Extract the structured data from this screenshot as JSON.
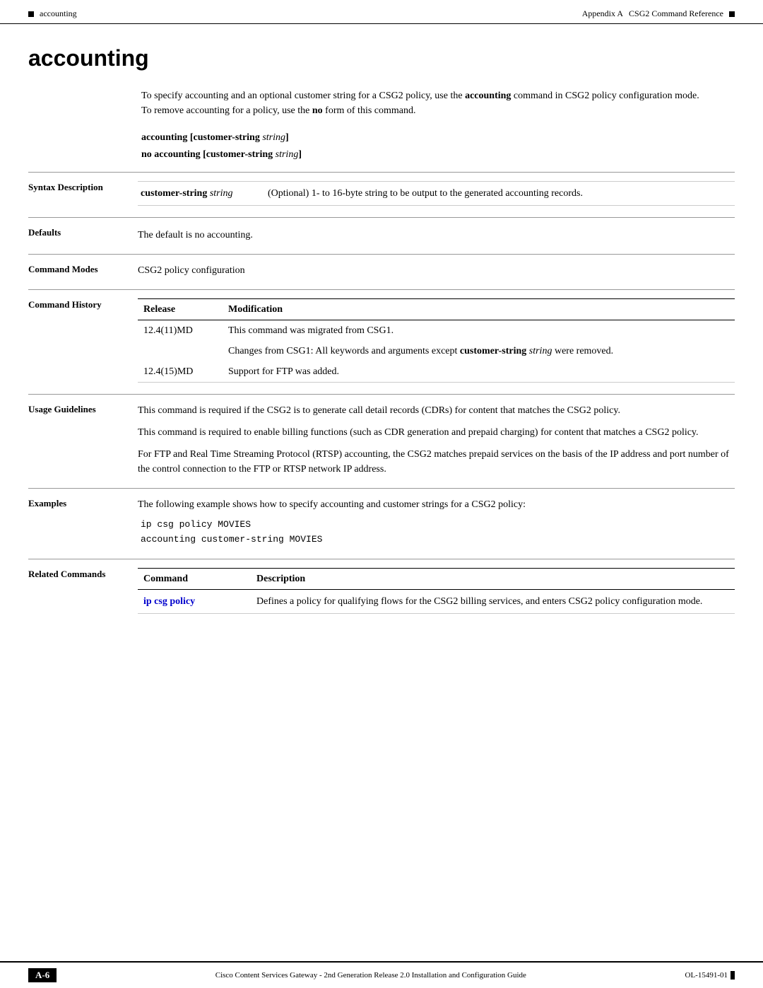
{
  "header": {
    "left_label": "accounting",
    "right_label": "Appendix A",
    "right_section": "CSG2 Command Reference"
  },
  "page_title": "accounting",
  "intro": {
    "text1": "To specify accounting and an optional customer string for a CSG2 policy, use the ",
    "bold1": "accounting",
    "text2": " command in CSG2 policy configuration mode. To remove accounting for a policy, use the ",
    "bold2": "no",
    "text3": " form of this command."
  },
  "syntax": {
    "line1_bold": "accounting [customer-string ",
    "line1_italic": "string",
    "line1_end": "]",
    "line2_start": "no accounting [customer-string ",
    "line2_italic": "string",
    "line2_end": "]"
  },
  "sections": {
    "syntax_description": {
      "label": "Syntax Description",
      "param_bold": "customer-string",
      "param_italic": " string",
      "param_desc": "Optional) 1- to 16-byte string to be output to the generated accounting records."
    },
    "defaults": {
      "label": "Defaults",
      "text": "The default is no accounting."
    },
    "command_modes": {
      "label": "Command Modes",
      "text": "CSG2 policy configuration"
    },
    "command_history": {
      "label": "Command History",
      "col1": "Release",
      "col2": "Modification",
      "rows": [
        {
          "release": "12.4(11)MD",
          "modification": "This command was migrated from CSG1."
        },
        {
          "release": "",
          "modification_text1": "Changes from CSG1: All keywords and arguments except ",
          "modification_bold": "customer-string",
          "modification_italic": " string",
          "modification_text2": " were removed."
        },
        {
          "release": "12.4(15)MD",
          "modification": "Support for FTP was added."
        }
      ]
    },
    "usage_guidelines": {
      "label": "Usage Guidelines",
      "paragraphs": [
        "This command is required if the CSG2 is to generate call detail records (CDRs) for content that matches the CSG2 policy.",
        "This command is required to enable billing functions (such as CDR generation and prepaid charging) for content that matches a CSG2 policy.",
        "For FTP and Real Time Streaming Protocol (RTSP) accounting, the CSG2 matches prepaid services on the basis of the IP address and port number of the control connection to the FTP or RTSP network IP address."
      ]
    },
    "examples": {
      "label": "Examples",
      "intro": "The following example shows how to specify accounting and customer strings for a CSG2 policy:",
      "code_line1": "ip csg policy MOVIES",
      "code_line2": " accounting customer-string MOVIES"
    },
    "related_commands": {
      "label": "Related Commands",
      "col1": "Command",
      "col2": "Description",
      "rows": [
        {
          "command": "ip csg policy",
          "description": "Defines a policy for qualifying flows for the CSG2 billing services, and enters CSG2 policy configuration mode."
        }
      ]
    }
  },
  "footer": {
    "page_num": "A-6",
    "center_text": "Cisco Content Services Gateway - 2nd Generation Release 2.0 Installation and Configuration Guide",
    "right_text": "OL-15491-01"
  }
}
